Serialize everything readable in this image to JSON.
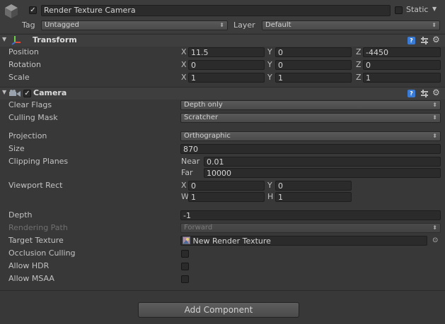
{
  "object": {
    "active": true,
    "name": "Render Texture Camera",
    "static_label": "Static",
    "static_checked": false,
    "tag_label": "Tag",
    "tag_value": "Untagged",
    "layer_label": "Layer",
    "layer_value": "Default"
  },
  "transform": {
    "title": "Transform",
    "position_label": "Position",
    "rotation_label": "Rotation",
    "scale_label": "Scale",
    "x_axis": "X",
    "y_axis": "Y",
    "z_axis": "Z",
    "position": {
      "x": "11.5",
      "y": "0",
      "z": "-4450"
    },
    "rotation": {
      "x": "0",
      "y": "0",
      "z": "0"
    },
    "scale": {
      "x": "1",
      "y": "1",
      "z": "1"
    }
  },
  "camera": {
    "title": "Camera",
    "enabled": true,
    "clear_flags_label": "Clear Flags",
    "clear_flags_value": "Depth only",
    "culling_mask_label": "Culling Mask",
    "culling_mask_value": "Scratcher",
    "projection_label": "Projection",
    "projection_value": "Orthographic",
    "size_label": "Size",
    "size_value": "870",
    "clipping_label": "Clipping Planes",
    "near_label": "Near",
    "near_value": "0.01",
    "far_label": "Far",
    "far_value": "10000",
    "viewport_label": "Viewport Rect",
    "vp_x_label": "X",
    "vp_x": "0",
    "vp_y_label": "Y",
    "vp_y": "0",
    "vp_w_label": "W",
    "vp_w": "1",
    "vp_h_label": "H",
    "vp_h": "1",
    "depth_label": "Depth",
    "depth_value": "-1",
    "rendering_path_label": "Rendering Path",
    "rendering_path_value": "Forward",
    "target_texture_label": "Target Texture",
    "target_texture_value": "New Render Texture",
    "occlusion_label": "Occlusion Culling",
    "occlusion_checked": false,
    "hdr_label": "Allow HDR",
    "hdr_checked": false,
    "msaa_label": "Allow MSAA",
    "msaa_checked": false
  },
  "add_component_label": "Add Component",
  "colors": {
    "background": "#383838",
    "field_bg": "#2b2b2b",
    "header_bg": "#3e3e3e",
    "help_icon": "#3a7bd5"
  },
  "icons": [
    "gameobject-cube-icon",
    "checkbox-check-icon",
    "transform-axes-icon",
    "camera-icon",
    "help-icon",
    "preset-icon",
    "gear-icon",
    "foldout-arrow-icon",
    "object-picker-icon",
    "render-texture-icon"
  ]
}
